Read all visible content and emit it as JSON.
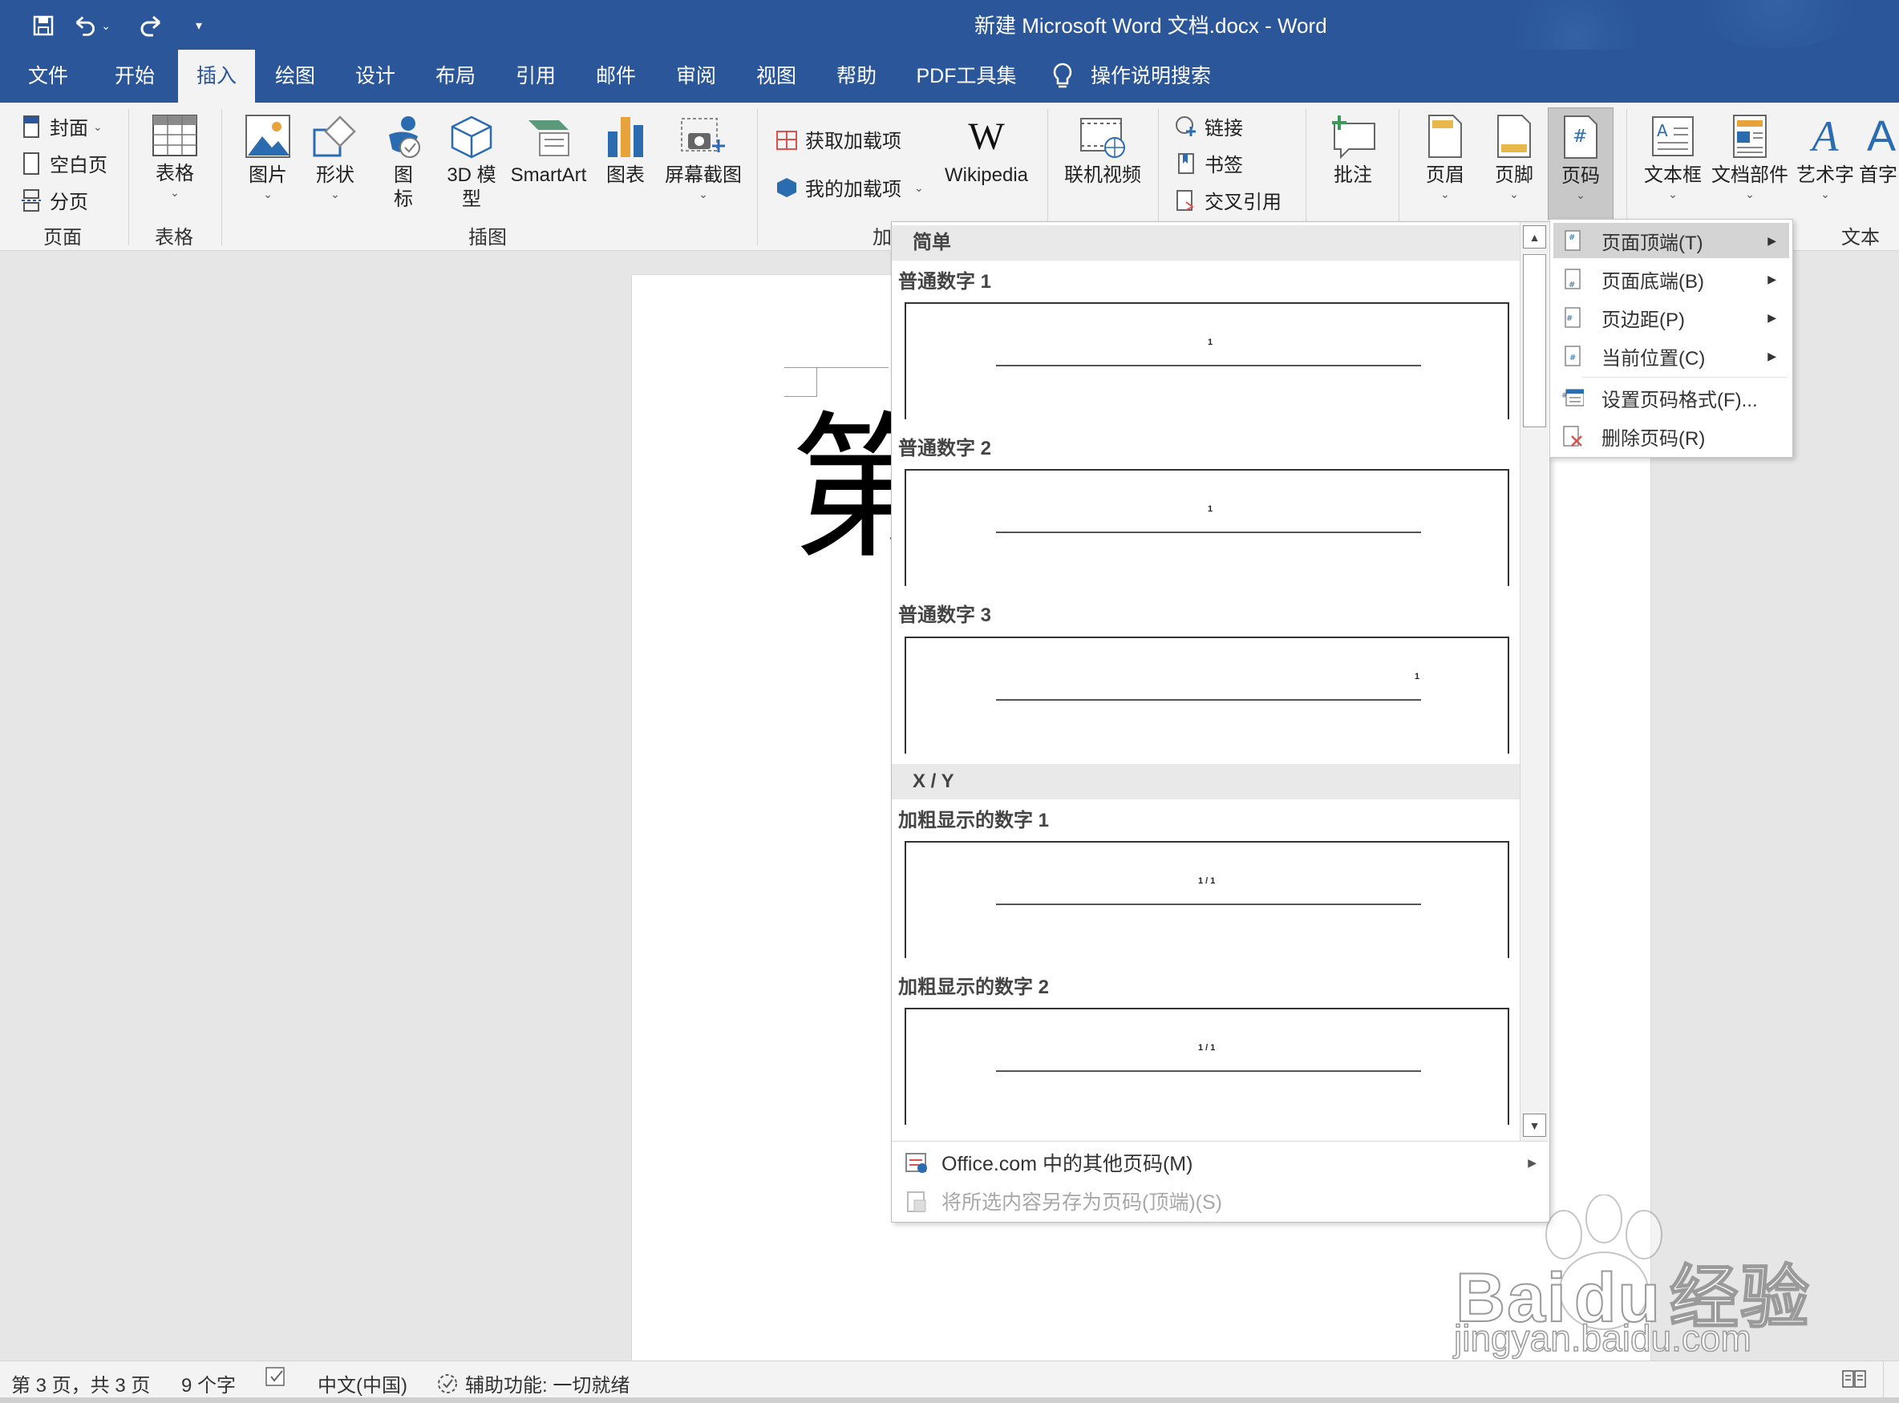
{
  "window": {
    "title": "新建 Microsoft Word 文档.docx  -  Word"
  },
  "quick_access": {
    "save_icon": "save-icon",
    "undo_icon": "undo-icon",
    "redo_icon": "redo-icon",
    "customize_icon": "customize-icon"
  },
  "tabs": [
    "文件",
    "开始",
    "插入",
    "绘图",
    "设计",
    "布局",
    "引用",
    "邮件",
    "审阅",
    "视图",
    "帮助",
    "PDF工具集"
  ],
  "active_tab": "插入",
  "tell_me": "操作说明搜索",
  "ribbon": {
    "pages": {
      "cover": "封面",
      "blank": "空白页",
      "break": "分页",
      "group": "页面"
    },
    "tables": {
      "table": "表格",
      "group": "表格"
    },
    "illustrations": {
      "picture": "图片",
      "shapes": "形状",
      "icons": "图\n标",
      "model3d": "3D 模\n型",
      "smartart": "SmartArt",
      "chart": "图表",
      "screenshot": "屏幕截图",
      "group": "插图"
    },
    "addins": {
      "get": "获取加载项",
      "mine": "我的加载项",
      "wikipedia": "Wikipedia",
      "group": "加"
    },
    "media": {
      "online_video": "联机视频"
    },
    "links": {
      "link": "链接",
      "bookmark": "书签",
      "cross_ref": "交叉引用"
    },
    "comments": {
      "comment": "批注"
    },
    "header_footer": {
      "header": "页眉",
      "footer": "页脚",
      "page_number": "页码"
    },
    "text": {
      "textbox": "文本框",
      "quick_parts": "文档部件",
      "wordart": "艺术字",
      "dropcap": "首字",
      "group": "文本"
    }
  },
  "document": {
    "heading_fragment": "第"
  },
  "gallery": {
    "sections": [
      {
        "header": "简单",
        "items": [
          {
            "title": "普通数字 1",
            "num": "1",
            "align": "center"
          },
          {
            "title": "普通数字 2",
            "num": "1",
            "align": "center"
          },
          {
            "title": "普通数字 3",
            "num": "1",
            "align": "right"
          }
        ]
      },
      {
        "header": "X / Y",
        "items": [
          {
            "title": "加粗显示的数字 1",
            "num": "1 / 1",
            "align": "center"
          },
          {
            "title": "加粗显示的数字 2",
            "num": "1 / 1",
            "align": "center"
          }
        ]
      }
    ],
    "footer": {
      "more": "Office.com 中的其他页码(M)",
      "save": "将所选内容另存为页码(顶端)(S)"
    }
  },
  "submenu": {
    "items": [
      {
        "label": "页面顶端(T)",
        "arrow": true,
        "highlighted": true
      },
      {
        "label": "页面底端(B)",
        "arrow": true
      },
      {
        "label": "页边距(P)",
        "arrow": true
      },
      {
        "label": "当前位置(C)",
        "arrow": true
      },
      {
        "label": "设置页码格式(F)...",
        "arrow": false
      },
      {
        "label": "删除页码(R)",
        "arrow": false
      }
    ]
  },
  "status": {
    "page": "第 3 页，共 3 页",
    "words": "9 个字",
    "language": "中文(中国)",
    "accessibility": "辅助功能: 一切就绪"
  },
  "watermark": {
    "brand": "Bai",
    "paw_text": "du",
    "cn": "经验",
    "url": "jingyan.baidu.com"
  },
  "colors": {
    "accent": "#2b579a",
    "ribbon_bg": "#f3f3f3",
    "menu_highlight": "#d4d4d4"
  }
}
